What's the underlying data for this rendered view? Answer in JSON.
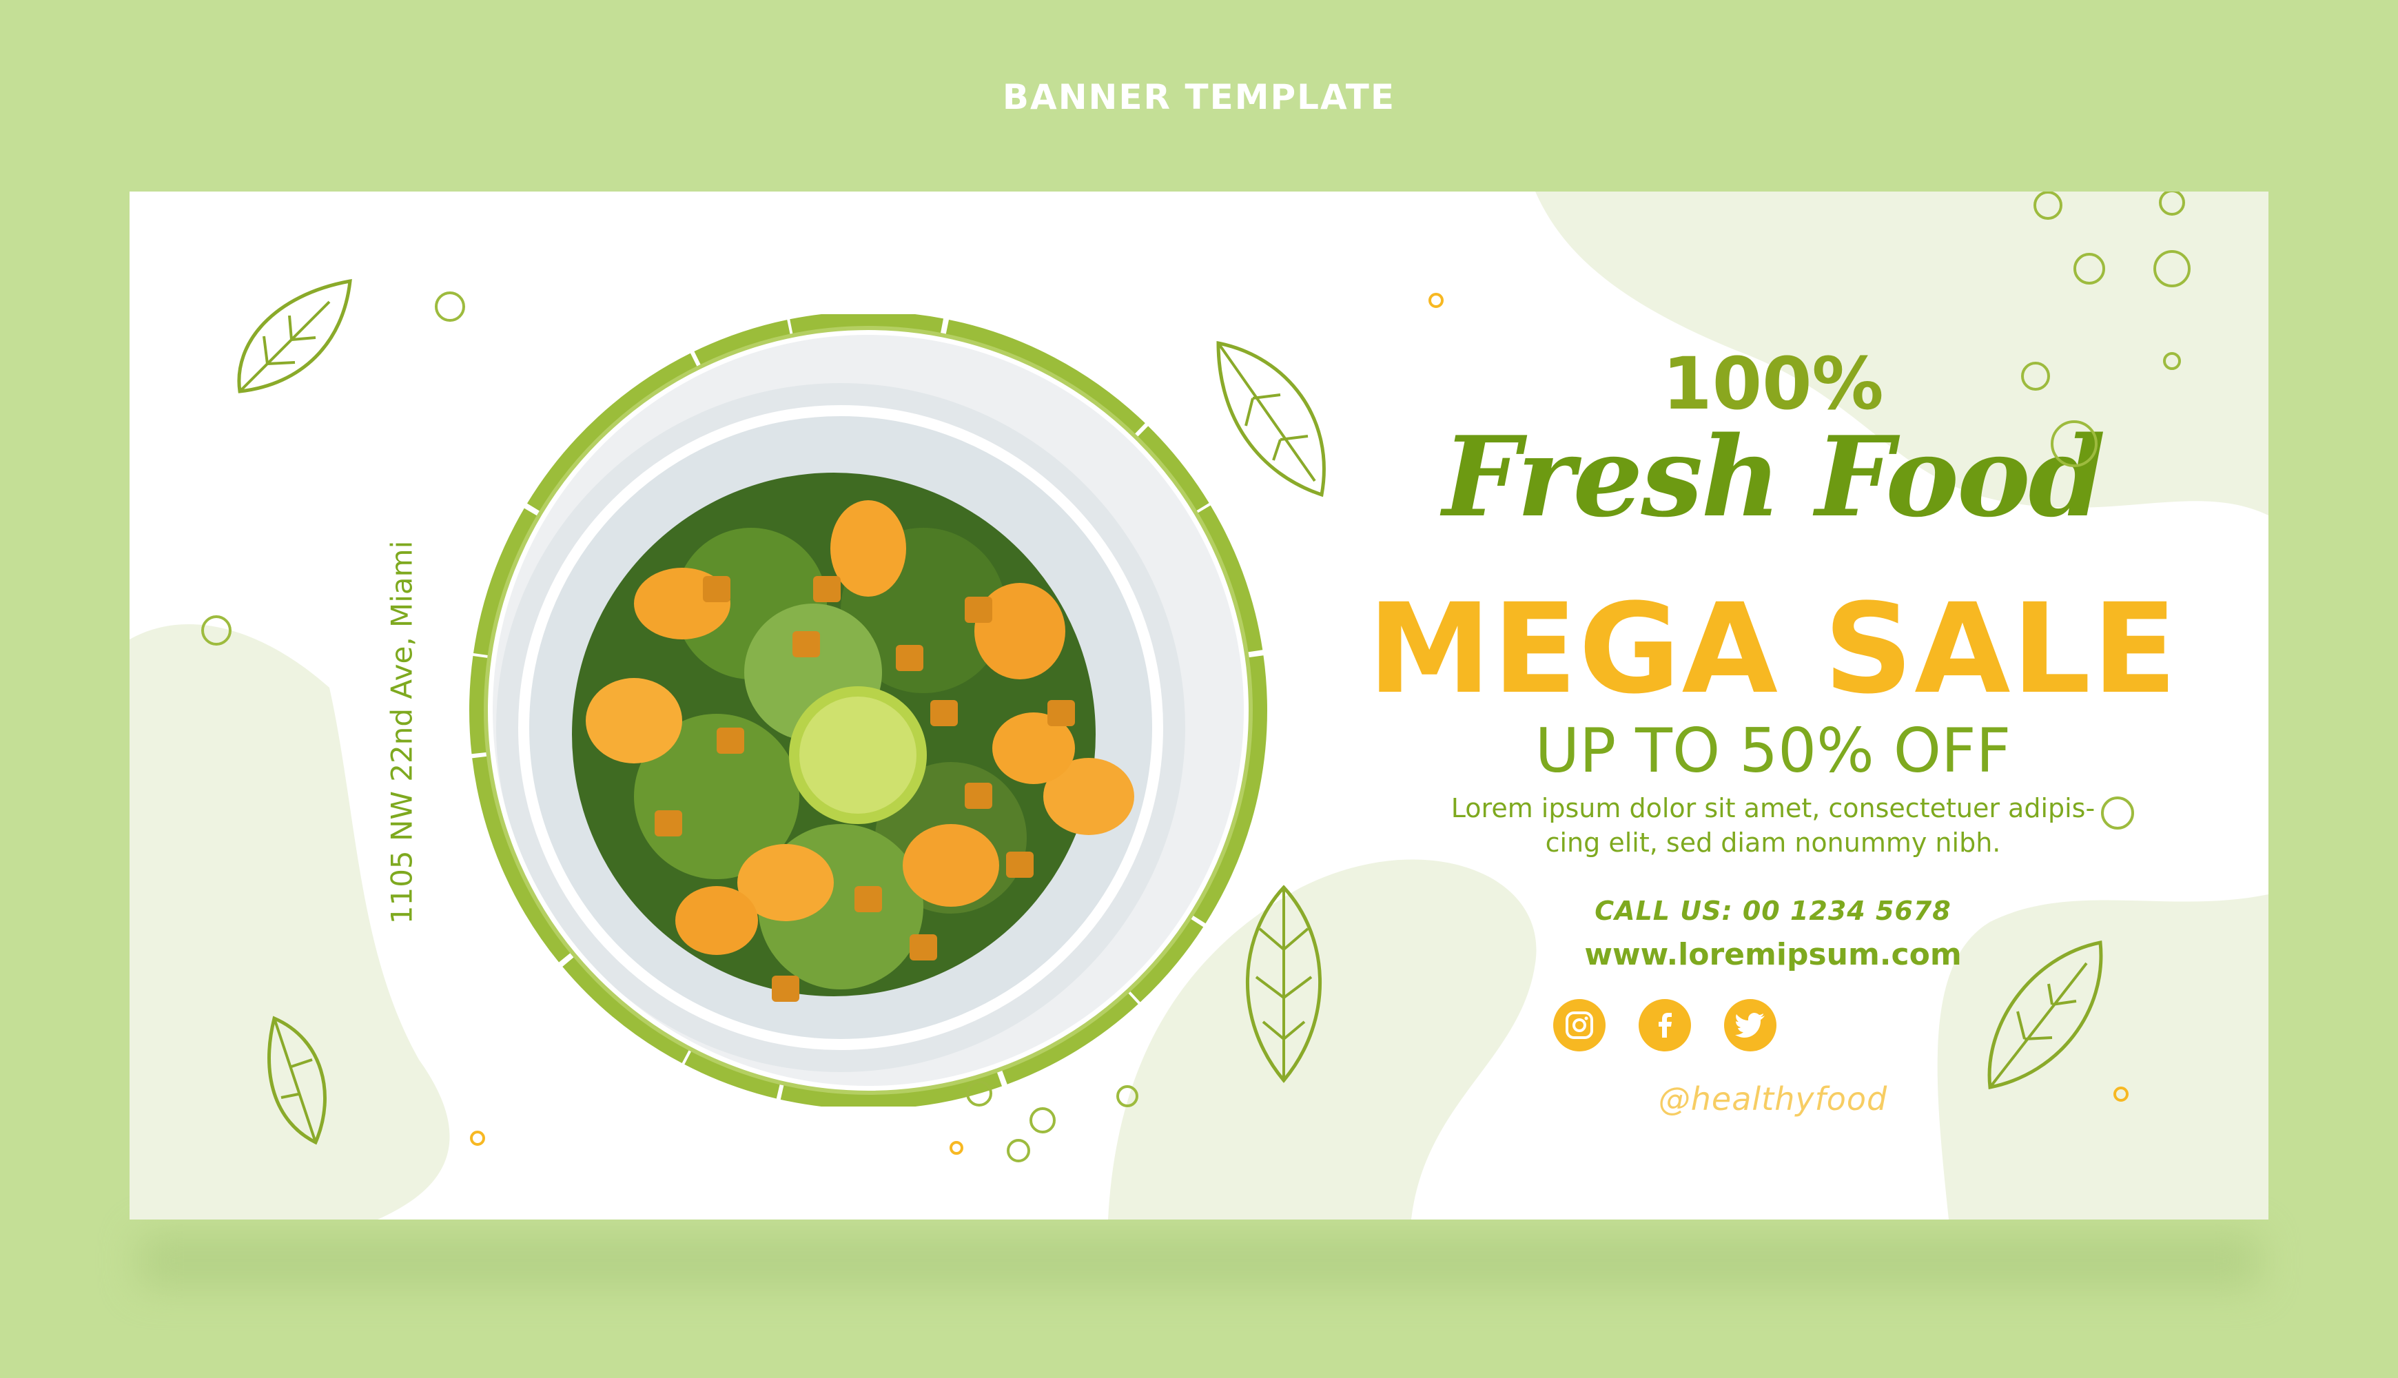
{
  "page": {
    "heading": "BANNER TEMPLATE"
  },
  "banner": {
    "address": "1105 NW 22nd Ave, Miami",
    "headline_percent": "100%",
    "headline_script": "Fresh Food",
    "sale_title": "MEGA SALE",
    "discount": "UP TO 50% OFF",
    "description_line1": "Lorem ipsum dolor sit amet, consectetuer adipis-",
    "description_line2": "cing elit, sed diam nonummy nibh.",
    "phone": "CALL US: 00 1234 5678",
    "website": "www.loremipsum.com",
    "social_icons": [
      "instagram-icon",
      "facebook-icon",
      "twitter-icon"
    ],
    "handle": "@healthyfood"
  },
  "colors": {
    "page_background": "#c4df96",
    "banner_background": "#ffffff",
    "green_text": "#7ea91f",
    "yellow_accent": "#f7b822",
    "light_green_blob": "#eef3e1"
  }
}
